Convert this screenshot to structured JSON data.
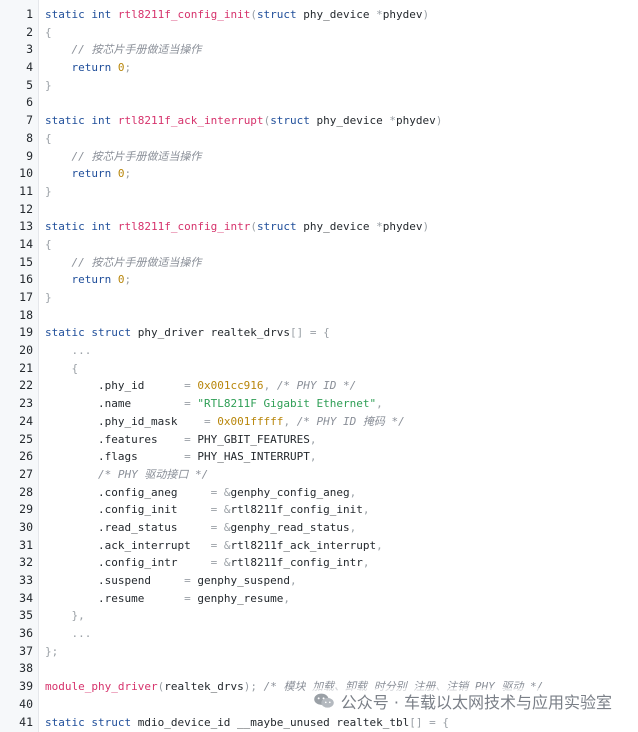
{
  "editor": {
    "lines": [
      {
        "n": "1",
        "t": [
          [
            "kw",
            "static int "
          ],
          [
            "fn",
            "rtl8211f_config_init"
          ],
          [
            "pn",
            "("
          ],
          [
            "kw",
            "struct "
          ],
          [
            "tx",
            "phy_device "
          ],
          [
            "pn",
            "*"
          ],
          [
            "tx",
            "phydev"
          ],
          [
            "pn",
            ")"
          ]
        ]
      },
      {
        "n": "2",
        "t": [
          [
            "pn",
            "{"
          ]
        ]
      },
      {
        "n": "3",
        "t": [
          [
            "tx",
            "    "
          ],
          [
            "cm",
            "// 按芯片手册做适当操作"
          ]
        ]
      },
      {
        "n": "4",
        "t": [
          [
            "tx",
            "    "
          ],
          [
            "kw",
            "return "
          ],
          [
            "num",
            "0"
          ],
          [
            "pn",
            ";"
          ]
        ]
      },
      {
        "n": "5",
        "t": [
          [
            "pn",
            "}"
          ]
        ]
      },
      {
        "n": "6",
        "t": []
      },
      {
        "n": "7",
        "t": [
          [
            "kw",
            "static int "
          ],
          [
            "fn",
            "rtl8211f_ack_interrupt"
          ],
          [
            "pn",
            "("
          ],
          [
            "kw",
            "struct "
          ],
          [
            "tx",
            "phy_device "
          ],
          [
            "pn",
            "*"
          ],
          [
            "tx",
            "phydev"
          ],
          [
            "pn",
            ")"
          ]
        ]
      },
      {
        "n": "8",
        "t": [
          [
            "pn",
            "{"
          ]
        ]
      },
      {
        "n": "9",
        "t": [
          [
            "tx",
            "    "
          ],
          [
            "cm",
            "// 按芯片手册做适当操作"
          ]
        ]
      },
      {
        "n": "10",
        "t": [
          [
            "tx",
            "    "
          ],
          [
            "kw",
            "return "
          ],
          [
            "num",
            "0"
          ],
          [
            "pn",
            ";"
          ]
        ]
      },
      {
        "n": "11",
        "t": [
          [
            "pn",
            "}"
          ]
        ]
      },
      {
        "n": "12",
        "t": []
      },
      {
        "n": "13",
        "t": [
          [
            "kw",
            "static int "
          ],
          [
            "fn",
            "rtl8211f_config_intr"
          ],
          [
            "pn",
            "("
          ],
          [
            "kw",
            "struct "
          ],
          [
            "tx",
            "phy_device "
          ],
          [
            "pn",
            "*"
          ],
          [
            "tx",
            "phydev"
          ],
          [
            "pn",
            ")"
          ]
        ]
      },
      {
        "n": "14",
        "t": [
          [
            "pn",
            "{"
          ]
        ]
      },
      {
        "n": "15",
        "t": [
          [
            "tx",
            "    "
          ],
          [
            "cm",
            "// 按芯片手册做适当操作"
          ]
        ]
      },
      {
        "n": "16",
        "t": [
          [
            "tx",
            "    "
          ],
          [
            "kw",
            "return "
          ],
          [
            "num",
            "0"
          ],
          [
            "pn",
            ";"
          ]
        ]
      },
      {
        "n": "17",
        "t": [
          [
            "pn",
            "}"
          ]
        ]
      },
      {
        "n": "18",
        "t": []
      },
      {
        "n": "19",
        "t": [
          [
            "kw",
            "static struct "
          ],
          [
            "tx",
            "phy_driver realtek_drvs"
          ],
          [
            "pn",
            "[] = {"
          ]
        ]
      },
      {
        "n": "20",
        "t": [
          [
            "tx",
            "    "
          ],
          [
            "pn",
            "..."
          ]
        ]
      },
      {
        "n": "21",
        "t": [
          [
            "tx",
            "    "
          ],
          [
            "pn",
            "{"
          ]
        ]
      },
      {
        "n": "22",
        "t": [
          [
            "tx",
            "        .phy_id      "
          ],
          [
            "pn",
            "= "
          ],
          [
            "num",
            "0x001cc916"
          ],
          [
            "pn",
            ", "
          ],
          [
            "cm",
            "/* PHY ID */"
          ]
        ]
      },
      {
        "n": "23",
        "t": [
          [
            "tx",
            "        .name        "
          ],
          [
            "pn",
            "= "
          ],
          [
            "str",
            "\"RTL8211F Gigabit Ethernet\""
          ],
          [
            "pn",
            ","
          ]
        ]
      },
      {
        "n": "24",
        "t": [
          [
            "tx",
            "        .phy_id_mask    "
          ],
          [
            "pn",
            "= "
          ],
          [
            "num",
            "0x001fffff"
          ],
          [
            "pn",
            ", "
          ],
          [
            "cm",
            "/* PHY ID 掩码 */"
          ]
        ]
      },
      {
        "n": "25",
        "t": [
          [
            "tx",
            "        .features    "
          ],
          [
            "pn",
            "= "
          ],
          [
            "tx",
            "PHY_GBIT_FEATURES"
          ],
          [
            "pn",
            ","
          ]
        ]
      },
      {
        "n": "26",
        "t": [
          [
            "tx",
            "        .flags       "
          ],
          [
            "pn",
            "= "
          ],
          [
            "tx",
            "PHY_HAS_INTERRUPT"
          ],
          [
            "pn",
            ","
          ]
        ]
      },
      {
        "n": "27",
        "t": [
          [
            "tx",
            "        "
          ],
          [
            "cm",
            "/* PHY 驱动接口 */"
          ]
        ]
      },
      {
        "n": "28",
        "t": [
          [
            "tx",
            "        .config_aneg     "
          ],
          [
            "pn",
            "= &"
          ],
          [
            "tx",
            "genphy_config_aneg"
          ],
          [
            "pn",
            ","
          ]
        ]
      },
      {
        "n": "29",
        "t": [
          [
            "tx",
            "        .config_init     "
          ],
          [
            "pn",
            "= &"
          ],
          [
            "tx",
            "rtl8211f_config_init"
          ],
          [
            "pn",
            ","
          ]
        ]
      },
      {
        "n": "30",
        "t": [
          [
            "tx",
            "        .read_status     "
          ],
          [
            "pn",
            "= &"
          ],
          [
            "tx",
            "genphy_read_status"
          ],
          [
            "pn",
            ","
          ]
        ]
      },
      {
        "n": "31",
        "t": [
          [
            "tx",
            "        .ack_interrupt   "
          ],
          [
            "pn",
            "= &"
          ],
          [
            "tx",
            "rtl8211f_ack_interrupt"
          ],
          [
            "pn",
            ","
          ]
        ]
      },
      {
        "n": "32",
        "t": [
          [
            "tx",
            "        .config_intr     "
          ],
          [
            "pn",
            "= &"
          ],
          [
            "tx",
            "rtl8211f_config_intr"
          ],
          [
            "pn",
            ","
          ]
        ]
      },
      {
        "n": "33",
        "t": [
          [
            "tx",
            "        .suspend     "
          ],
          [
            "pn",
            "= "
          ],
          [
            "tx",
            "genphy_suspend"
          ],
          [
            "pn",
            ","
          ]
        ]
      },
      {
        "n": "34",
        "t": [
          [
            "tx",
            "        .resume      "
          ],
          [
            "pn",
            "= "
          ],
          [
            "tx",
            "genphy_resume"
          ],
          [
            "pn",
            ","
          ]
        ]
      },
      {
        "n": "35",
        "t": [
          [
            "tx",
            "    "
          ],
          [
            "pn",
            "},"
          ]
        ]
      },
      {
        "n": "36",
        "t": [
          [
            "tx",
            "    "
          ],
          [
            "pn",
            "..."
          ]
        ]
      },
      {
        "n": "37",
        "t": [
          [
            "pn",
            "};"
          ]
        ]
      },
      {
        "n": "38",
        "t": []
      },
      {
        "n": "39",
        "t": [
          [
            "fn",
            "module_phy_driver"
          ],
          [
            "pn",
            "("
          ],
          [
            "tx",
            "realtek_drvs"
          ],
          [
            "pn",
            "); "
          ],
          [
            "cm",
            "/* 模块 加载、卸载 时分别 注册、注销 PHY 驱动 */"
          ]
        ]
      },
      {
        "n": "40",
        "t": []
      },
      {
        "n": "41",
        "t": [
          [
            "kw",
            "static struct "
          ],
          [
            "tx",
            "mdio_device_id __maybe_unused realtek_tbl"
          ],
          [
            "pn",
            "[] = {"
          ]
        ]
      }
    ]
  },
  "watermark": {
    "text": "公众号 · 车载以太网技术与应用实验室",
    "icon": "wechat-icon"
  },
  "colors": {
    "keyword": "#1f4e9a",
    "function": "#d6336c",
    "comment": "#8a8f98",
    "number": "#b8860b",
    "string": "#2e9e55"
  }
}
